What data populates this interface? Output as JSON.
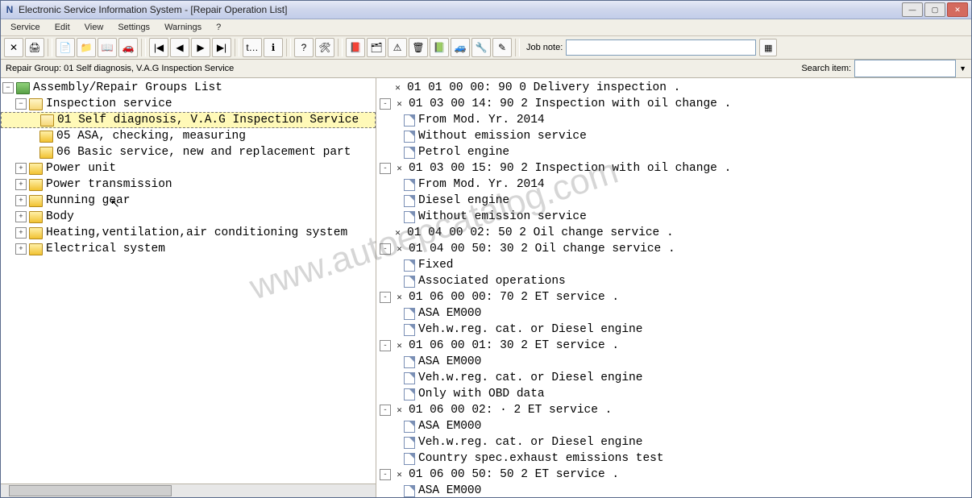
{
  "window": {
    "title": "Electronic Service Information System - [Repair Operation List]"
  },
  "menu": [
    "Service",
    "Edit",
    "View",
    "Settings",
    "Warnings",
    "?"
  ],
  "jobnote": {
    "label": "Job note:",
    "placeholder": ""
  },
  "infobar": {
    "repair_group": "Repair Group: 01 Self diagnosis, V.A.G Inspection Service",
    "search_label": "Search item:"
  },
  "left_tree": {
    "root": {
      "label": "Assembly/Repair Groups List",
      "expanded": true
    },
    "inspection": {
      "label": "Inspection service",
      "expanded": true,
      "children": [
        "01 Self diagnosis, V.A.G Inspection Service",
        "05 ASA, checking, measuring",
        "06 Basic service, new and replacement part"
      ]
    },
    "others": [
      "Power unit",
      "Power transmission",
      "Running gear",
      "Body",
      "Heating,ventilation,air conditioning system",
      "Electrical system"
    ]
  },
  "ops": [
    {
      "t": "op",
      "text": "01 01 00 00:      90 0 Delivery inspection ."
    },
    {
      "t": "op",
      "text": "01 03 00 14:      90 2 Inspection with oil change .",
      "exp": "-"
    },
    {
      "t": "sub",
      "text": "From Mod. Yr. 2014"
    },
    {
      "t": "sub",
      "text": "Without emission service"
    },
    {
      "t": "sub",
      "text": "Petrol engine"
    },
    {
      "t": "op",
      "text": "01 03 00 15:      90 2 Inspection with oil change .",
      "exp": "-"
    },
    {
      "t": "sub",
      "text": "From Mod. Yr. 2014"
    },
    {
      "t": "sub",
      "text": "Diesel engine"
    },
    {
      "t": "sub",
      "text": "Without emission service"
    },
    {
      "t": "op",
      "text": "01 04 00 02:      50 2 Oil change service ."
    },
    {
      "t": "op",
      "text": "01 04 00 50:      30 2 Oil change service .",
      "exp": "-"
    },
    {
      "t": "sub",
      "text": "Fixed"
    },
    {
      "t": "sub",
      "text": "Associated operations"
    },
    {
      "t": "op",
      "text": "01 06 00 00:      70 2 ET service .",
      "exp": "-"
    },
    {
      "t": "sub",
      "text": "ASA EM000"
    },
    {
      "t": "sub",
      "text": "Veh.w.reg. cat. or Diesel engine"
    },
    {
      "t": "op",
      "text": "01 06 00 01:      30 2 ET service .",
      "exp": "-"
    },
    {
      "t": "sub",
      "text": "ASA EM000"
    },
    {
      "t": "sub",
      "text": "Veh.w.reg. cat. or Diesel engine"
    },
    {
      "t": "sub",
      "text": "Only with OBD data"
    },
    {
      "t": "op",
      "text": "01 06 00 02:       · 2 ET service .",
      "exp": "-"
    },
    {
      "t": "sub",
      "text": "ASA EM000"
    },
    {
      "t": "sub",
      "text": "Veh.w.reg. cat. or Diesel engine"
    },
    {
      "t": "sub",
      "text": "Country spec.exhaust emissions test"
    },
    {
      "t": "op",
      "text": "01 06 00 50:      50 2 ET service .",
      "exp": "-"
    },
    {
      "t": "sub",
      "text": "ASA EM000"
    }
  ],
  "toolbar_icons": [
    "✕",
    "🖨",
    "📄",
    "📁",
    "📖",
    "🚗",
    "|◀",
    "◀",
    "▶",
    "▶|",
    "t…",
    "ℹ",
    "?",
    "🛠",
    "📕",
    "🗂",
    "⚠",
    "🗑",
    "📗",
    "🚙",
    "🔧",
    "✎"
  ],
  "watermark": "www.autoepcatalog.com"
}
